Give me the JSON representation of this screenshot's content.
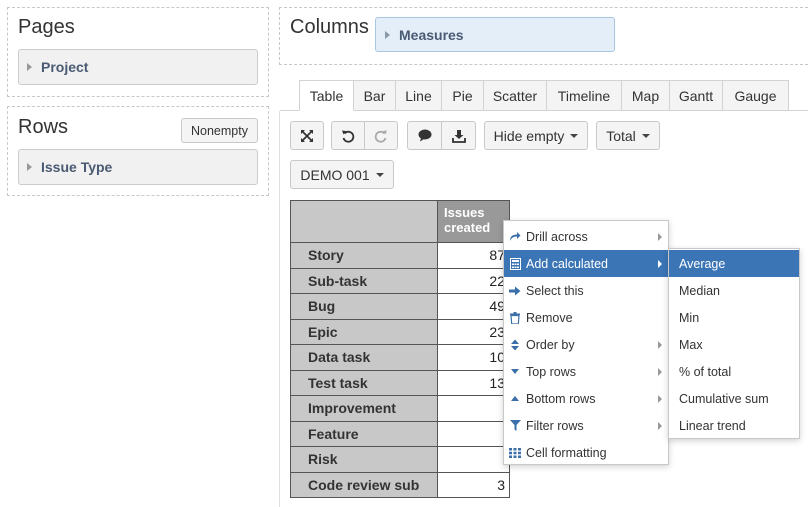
{
  "pages_panel": {
    "title": "Pages",
    "dimension": "Project"
  },
  "rows_panel": {
    "title": "Rows",
    "nonempty_label": "Nonempty",
    "dimension": "Issue Type"
  },
  "columns_panel": {
    "title": "Columns",
    "dimension": "Measures"
  },
  "tabs": [
    "Table",
    "Bar",
    "Line",
    "Pie",
    "Scatter",
    "Timeline",
    "Map",
    "Gantt",
    "Gauge"
  ],
  "toolbar": {
    "hide_empty_label": "Hide empty",
    "total_label": "Total",
    "project_label": "DEMO 001"
  },
  "grid": {
    "measure_header": "Issues created",
    "rows": [
      {
        "label": "Story",
        "value": "87"
      },
      {
        "label": "Sub-task",
        "value": "22"
      },
      {
        "label": "Bug",
        "value": "49"
      },
      {
        "label": "Epic",
        "value": "23"
      },
      {
        "label": "Data task",
        "value": "10"
      },
      {
        "label": "Test task",
        "value": "13"
      },
      {
        "label": "Improvement",
        "value": ""
      },
      {
        "label": "Feature",
        "value": ""
      },
      {
        "label": "Risk",
        "value": ""
      },
      {
        "label": "Code review sub",
        "value": "3"
      }
    ]
  },
  "context_menu": {
    "items": [
      {
        "label": "Drill across",
        "icon": "share-arrow-icon",
        "submenu": true
      },
      {
        "label": "Add calculated",
        "icon": "calculator-icon",
        "submenu": true,
        "active": true
      },
      {
        "label": "Select this",
        "icon": "arrow-right-icon",
        "submenu": false
      },
      {
        "label": "Remove",
        "icon": "trash-icon",
        "submenu": false
      },
      {
        "label": "Order by",
        "icon": "sort-icon",
        "submenu": true
      },
      {
        "label": "Top rows",
        "icon": "caret-down-icon",
        "submenu": true
      },
      {
        "label": "Bottom rows",
        "icon": "caret-up-icon",
        "submenu": true
      },
      {
        "label": "Filter rows",
        "icon": "filter-icon",
        "submenu": true
      },
      {
        "label": "Cell formatting",
        "icon": "grid-icon",
        "submenu": false
      }
    ]
  },
  "calc_submenu": {
    "items": [
      "Average",
      "Median",
      "Min",
      "Max",
      "% of total",
      "Cumulative sum",
      "Linear trend"
    ],
    "active_index": 0
  },
  "colors": {
    "accent": "#3b75b6",
    "header_bg": "#999999",
    "row_header_bg": "#c8c8c8",
    "measure_bg": "#e3eef9"
  }
}
